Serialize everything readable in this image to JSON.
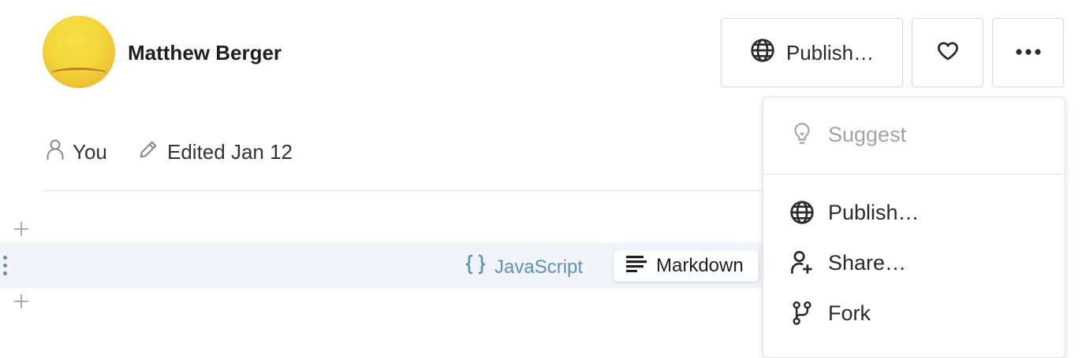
{
  "header": {
    "author_name": "Matthew Berger",
    "publish_label": "Publish…"
  },
  "meta": {
    "owner_label": "You",
    "edited_label": "Edited Jan 12"
  },
  "cell": {
    "javascript_label": "JavaScript",
    "markdown_label": "Markdown"
  },
  "menu": {
    "items": [
      {
        "label": "Suggest",
        "icon": "lightbulb-icon",
        "disabled": true
      },
      {
        "label": "Publish…",
        "icon": "globe-icon"
      },
      {
        "label": "Share…",
        "icon": "add-user-icon"
      },
      {
        "label": "Fork",
        "icon": "fork-icon"
      }
    ]
  },
  "colors": {
    "accent_blue": "#5e8fc3",
    "cell_highlight": "#f1f5fa",
    "disabled_text": "#a3a3a3"
  }
}
